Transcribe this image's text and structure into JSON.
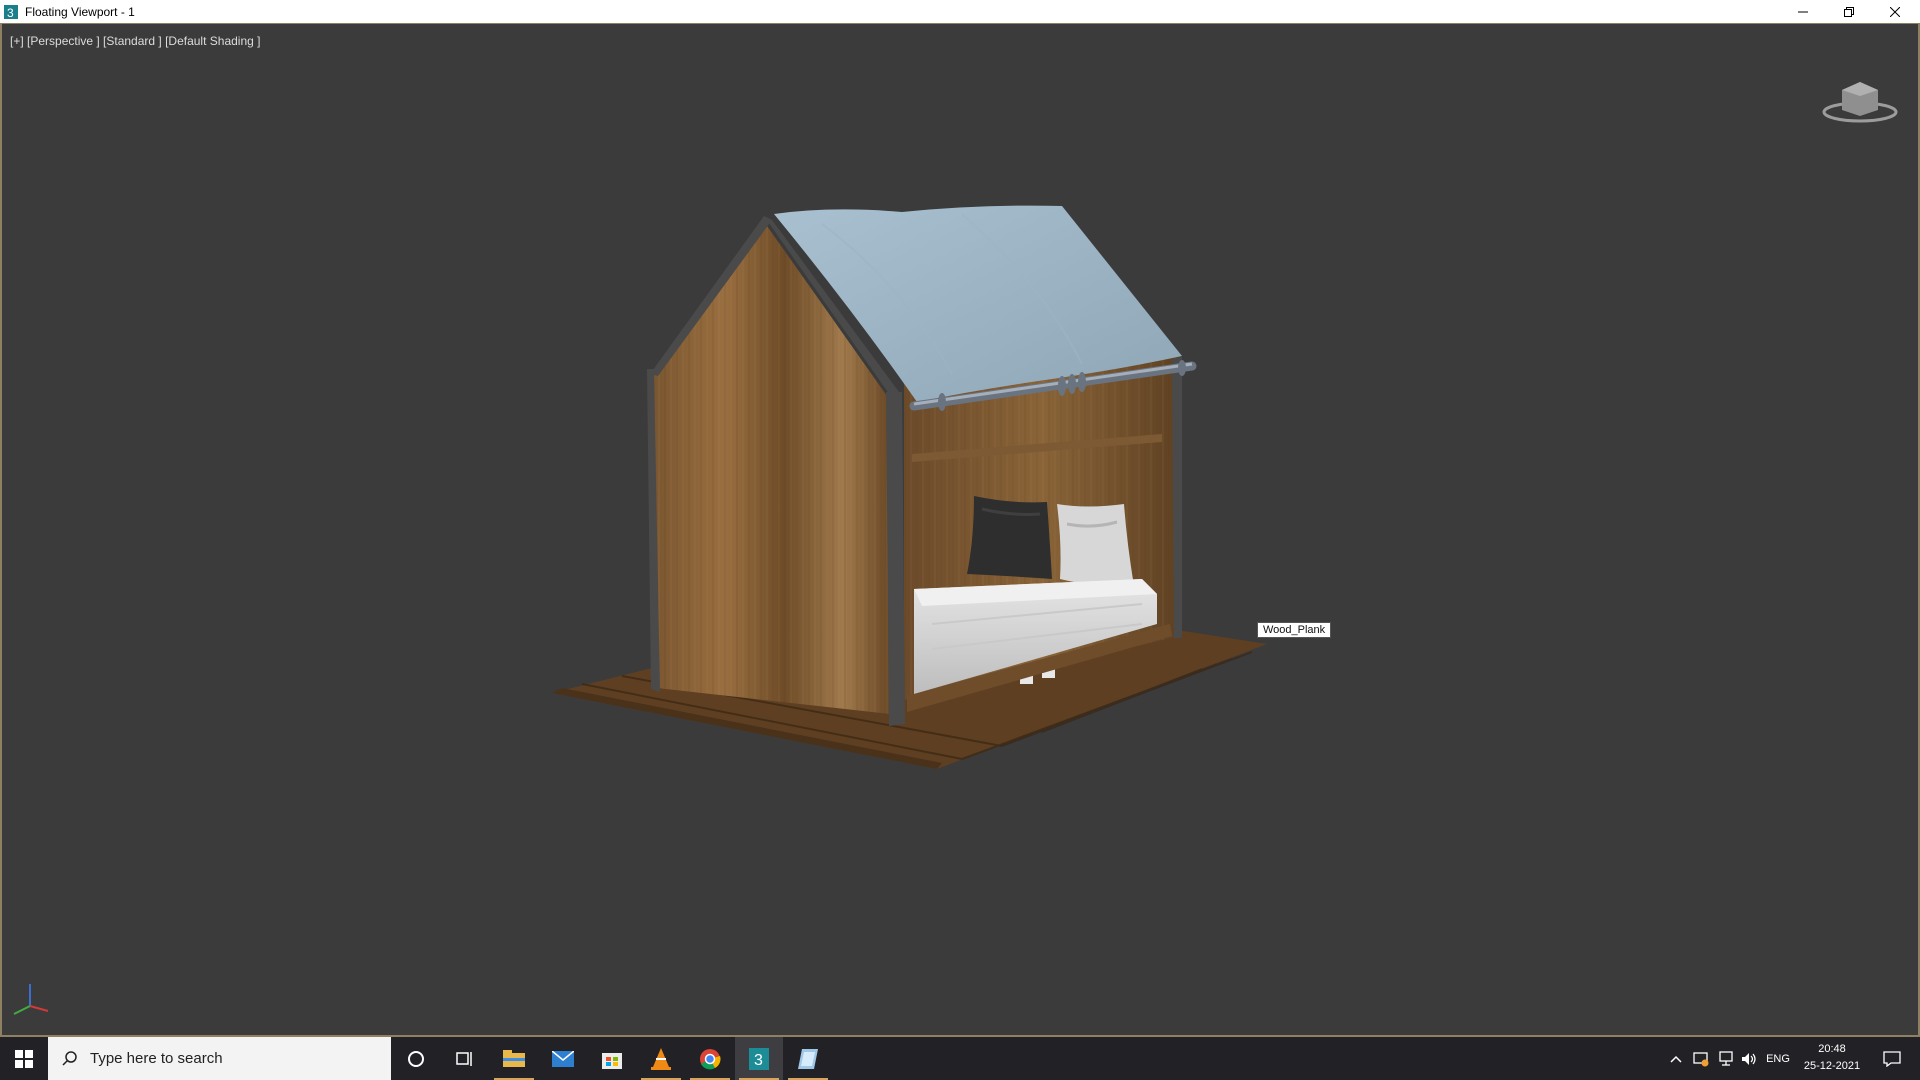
{
  "window": {
    "title": "Floating Viewport - 1",
    "app_icon": "3ds-max-icon",
    "controls": [
      "minimize-icon",
      "restore-icon",
      "close-icon"
    ]
  },
  "viewport": {
    "label": "[+] [Perspective ] [Standard ] [Default Shading ]",
    "tooltip": "Wood_Plank",
    "background": "#3b3b3b",
    "border_color": "#8e8163"
  },
  "taskbar": {
    "search_placeholder": "Type here to search",
    "pinned": [
      "cortana-icon",
      "task-view-icon",
      "file-explorer-icon",
      "mail-icon",
      "store-icon",
      "vlc-icon",
      "chrome-icon",
      "3ds-max-icon",
      "app-icon"
    ],
    "tray": {
      "language": "ENG",
      "time": "20:48",
      "date": "25-12-2021"
    },
    "accent": "#d8a45a"
  }
}
